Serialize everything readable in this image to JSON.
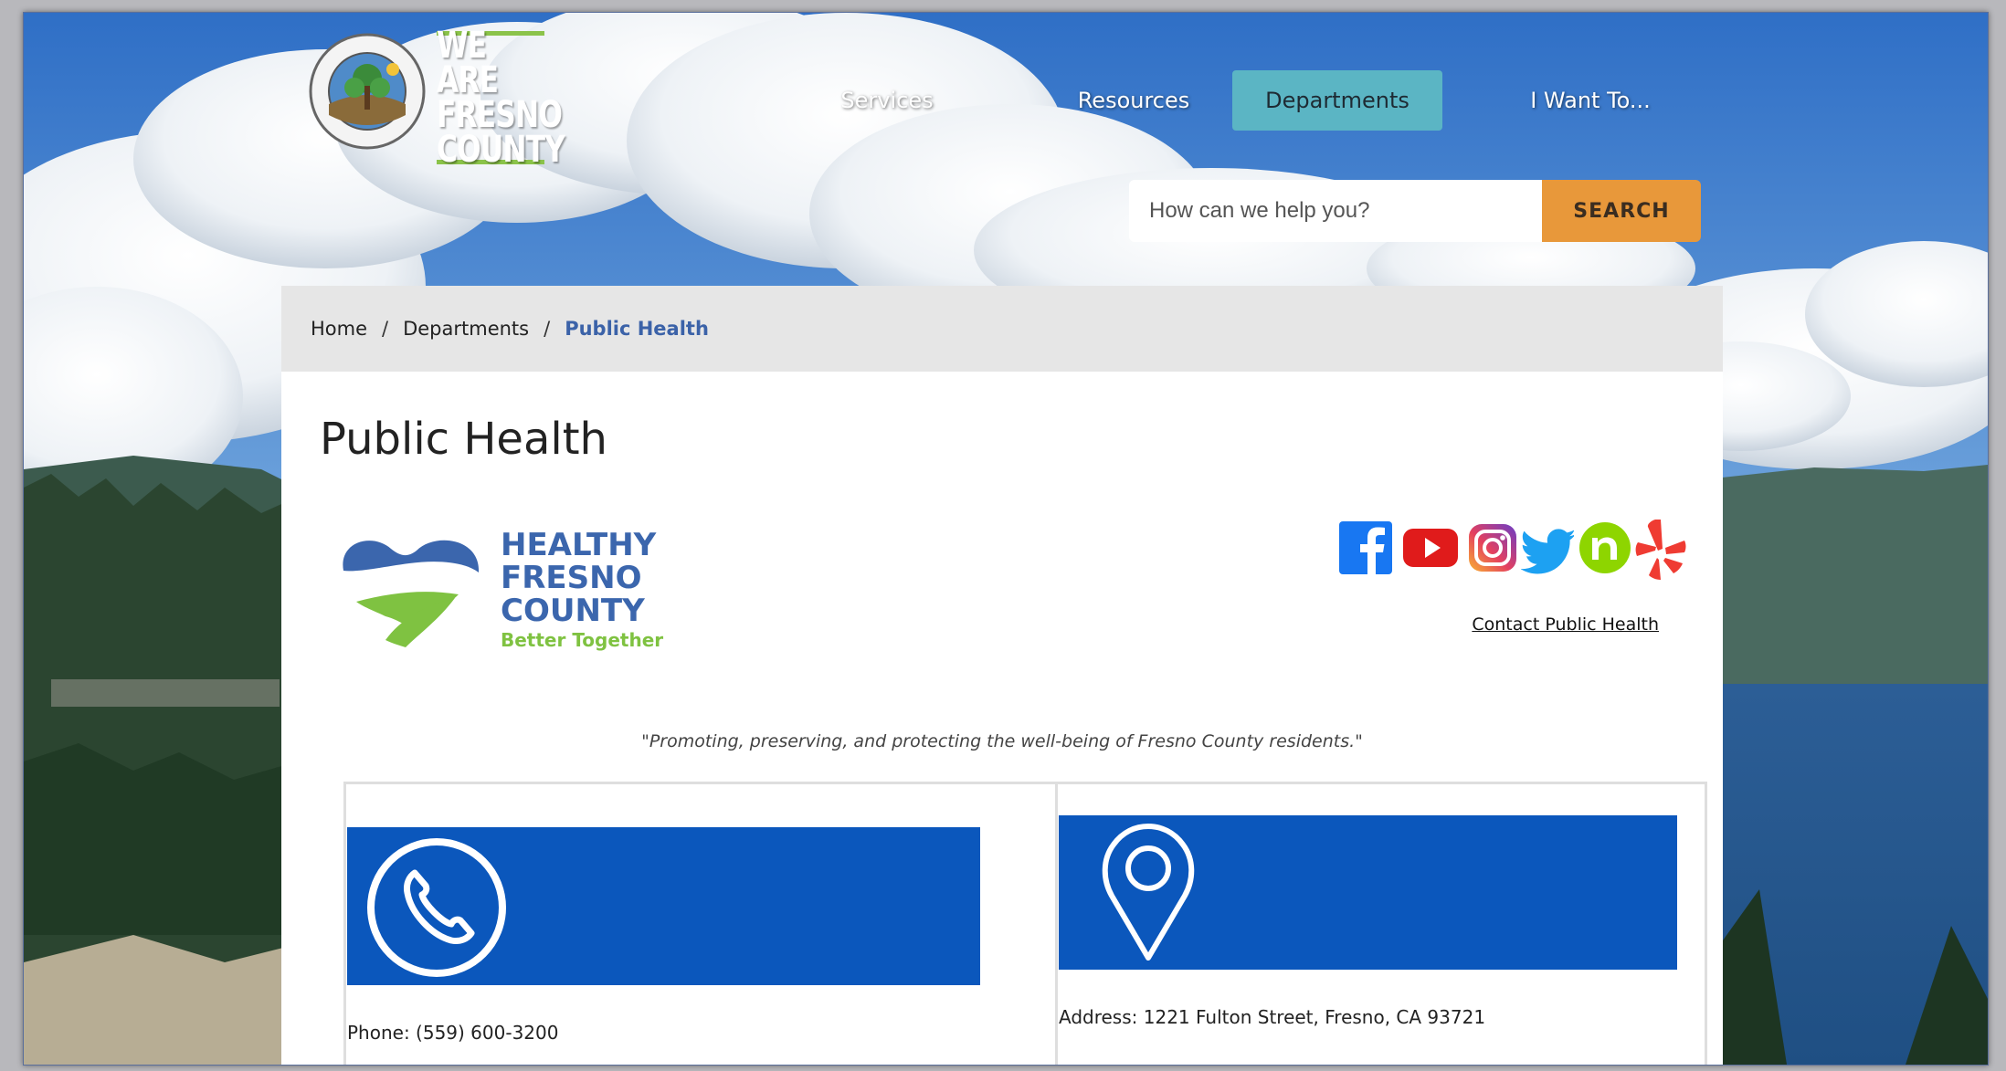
{
  "header": {
    "logo_seal_name": "county-seal-logo",
    "logo_text_lines": [
      "WE ARE",
      "FRESNO",
      "COUNTY"
    ],
    "nav": {
      "services": "Services",
      "resources": "Resources",
      "departments": "Departments",
      "i_want_to": "I Want To..."
    },
    "search": {
      "placeholder": "How can we help you?",
      "button_label": "SEARCH"
    }
  },
  "breadcrumb": {
    "home": "Home",
    "separator": "/",
    "departments": "Departments",
    "current": "Public Health"
  },
  "page": {
    "title": "Public Health",
    "logo": {
      "lines": [
        "HEALTHY",
        "FRESNO",
        "COUNTY"
      ],
      "tagline": "Better Together"
    },
    "social_icons": [
      "facebook-icon",
      "youtube-icon",
      "instagram-icon",
      "twitter-icon",
      "nextdoor-icon",
      "yelp-icon"
    ],
    "contact_link": "Contact Public Health",
    "mission": "\"Promoting, preserving, and protecting the well-being of Fresno County residents.\"",
    "cards": {
      "phone": {
        "icon": "phone-icon",
        "text": "Phone: (559) 600-3200"
      },
      "address": {
        "icon": "map-pin-icon",
        "text": "Address: 1221 Fulton Street, Fresno, CA 93721"
      }
    }
  },
  "colors": {
    "nav_active": "#5bb5c4",
    "search_button": "#e8983a",
    "card_banner": "#0b57bc",
    "breadcrumb_active": "#3b62a8",
    "logo_blue": "#3b66ad",
    "logo_green": "#7fc241"
  }
}
